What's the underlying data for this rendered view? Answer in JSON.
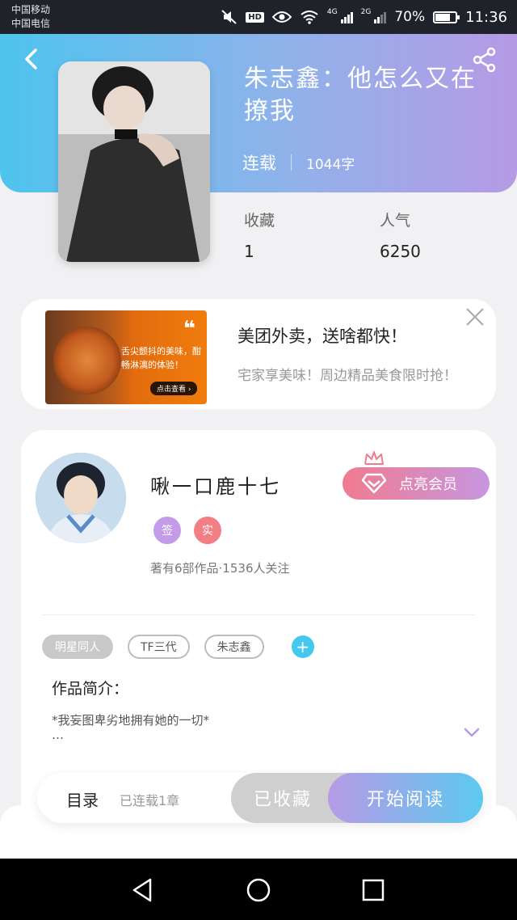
{
  "status_bar": {
    "carrier_1": "中国移动",
    "carrier_2": "中国电信",
    "net_1": "4G",
    "net_2": "2G",
    "battery": "70%",
    "battery_level": 0.7,
    "time": "11:36",
    "icons": [
      "mute-icon",
      "hd-icon",
      "eye-icon",
      "wifi-icon",
      "signal-icon",
      "battery-icon"
    ]
  },
  "header": {
    "back_icon": "back-arrow-icon",
    "share_icon": "share-icon",
    "gradient_colors": [
      "#4ec4ef",
      "#b69ae6"
    ]
  },
  "book": {
    "title": "朱志鑫：他怎么又在撩我",
    "status": "连载",
    "word_count": "1044字",
    "favorites_label": "收藏",
    "favorites_value": "1",
    "popularity_label": "人气",
    "popularity_value": "6250"
  },
  "ad": {
    "image_text": "舌尖颤抖的美味，酣畅淋漓的体验！",
    "image_button": "点击查看 ›",
    "title": "美团外卖，送啥都快！",
    "description": "宅家享美味！周边精品美食限时抢！",
    "close_icon": "close-icon"
  },
  "author": {
    "name": "啾一口鹿十七",
    "badges": [
      "签",
      "实"
    ],
    "stats": "著有6部作品·1536人关注",
    "vip_button": "点亮会员",
    "vip_icon": "diamond-icon",
    "crown_icon": "crown-icon"
  },
  "tags": [
    "明星同人",
    "TF三代",
    "朱志鑫"
  ],
  "intro": {
    "title": "作品简介：",
    "text": "*我妄图卑劣地拥有她的一切*",
    "ellipsis": "…",
    "expand_icon": "chevron-down-icon"
  },
  "actions": {
    "toc_label": "目录",
    "toc_count": "已连载1章",
    "collected": "已收藏",
    "start_reading": "开始阅读"
  },
  "nav": [
    "back-triangle-icon",
    "home-circle-icon",
    "recent-square-icon"
  ]
}
